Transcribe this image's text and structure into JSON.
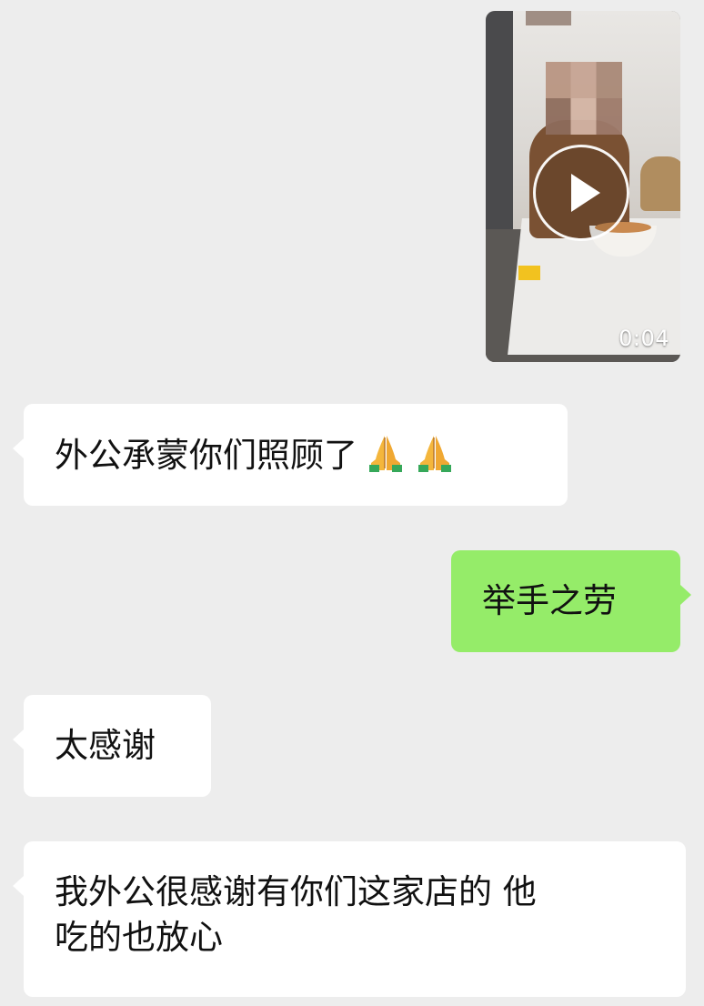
{
  "video_message": {
    "duration": "0:04",
    "icon": "play-icon"
  },
  "messages": [
    {
      "side": "incoming",
      "text": "外公承蒙你们照顾了",
      "emoji": [
        "folded-hands-icon",
        "folded-hands-icon"
      ]
    },
    {
      "side": "outgoing",
      "text": "举手之劳"
    },
    {
      "side": "incoming",
      "text": "太感谢"
    },
    {
      "side": "incoming",
      "line1": "我外公很感谢有你们这家店的 他",
      "line2": "吃的也放心"
    }
  ],
  "colors": {
    "background": "#ededed",
    "incoming_bubble": "#ffffff",
    "outgoing_bubble": "#95ec69"
  }
}
